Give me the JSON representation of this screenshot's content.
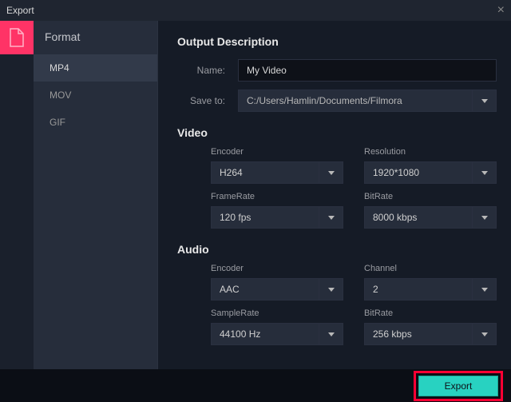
{
  "window": {
    "title": "Export"
  },
  "tabs": {
    "active_icon": "document-icon"
  },
  "sidebar": {
    "header": "Format",
    "items": [
      {
        "label": "MP4",
        "active": true
      },
      {
        "label": "MOV",
        "active": false
      },
      {
        "label": "GIF",
        "active": false
      }
    ]
  },
  "output": {
    "section_title": "Output Description",
    "name_label": "Name:",
    "name_value": "My Video",
    "saveto_label": "Save to:",
    "saveto_value": "C:/Users/Hamlin/Documents/Filmora"
  },
  "video": {
    "section_title": "Video",
    "encoder_label": "Encoder",
    "encoder_value": "H264",
    "resolution_label": "Resolution",
    "resolution_value": "1920*1080",
    "framerate_label": "FrameRate",
    "framerate_value": "120 fps",
    "bitrate_label": "BitRate",
    "bitrate_value": "8000 kbps"
  },
  "audio": {
    "section_title": "Audio",
    "encoder_label": "Encoder",
    "encoder_value": "AAC",
    "channel_label": "Channel",
    "channel_value": "2",
    "samplerate_label": "SampleRate",
    "samplerate_value": "44100 Hz",
    "bitrate_label": "BitRate",
    "bitrate_value": "256 kbps"
  },
  "footer": {
    "export_label": "Export"
  }
}
